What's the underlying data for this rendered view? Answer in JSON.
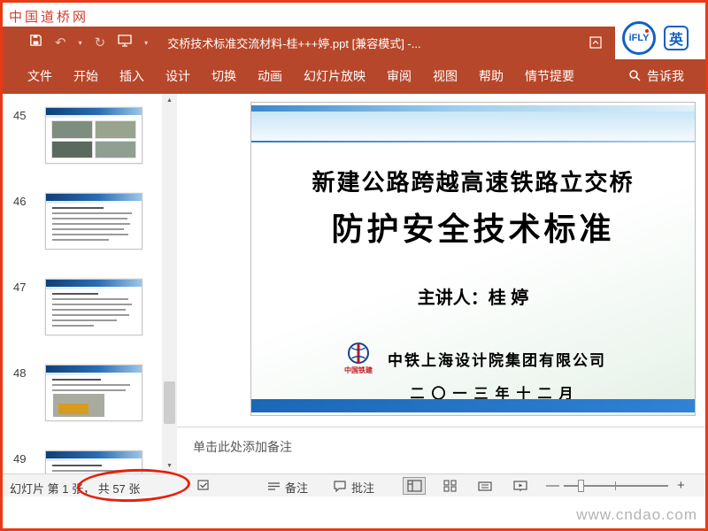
{
  "watermarks": {
    "top_left": "中国道桥网",
    "bottom_right": "www.cndao.com"
  },
  "ime": {
    "ifly": "iFLY",
    "lang": "英"
  },
  "titlebar": {
    "title": "交桥技术标准交流材料-桂+++婷.ppt [兼容模式]  -...",
    "undo_glyph": "↶",
    "redo_glyph": "↻",
    "qat_caret": "▾"
  },
  "ribbon": {
    "tabs": [
      {
        "label": "文件"
      },
      {
        "label": "开始"
      },
      {
        "label": "插入"
      },
      {
        "label": "设计"
      },
      {
        "label": "切换"
      },
      {
        "label": "动画"
      },
      {
        "label": "幻灯片放映"
      },
      {
        "label": "审阅"
      },
      {
        "label": "视图"
      },
      {
        "label": "帮助"
      },
      {
        "label": "情节提要"
      }
    ],
    "tellme_label": "告诉我"
  },
  "thumbs": {
    "scroll_up_glyph": "▲",
    "scroll_down_glyph": "▼",
    "slides": [
      {
        "number": "45"
      },
      {
        "number": "46"
      },
      {
        "number": "47"
      },
      {
        "number": "48"
      },
      {
        "number": "49"
      }
    ]
  },
  "slide": {
    "title_line1": "新建公路跨越高速铁路立交桥",
    "title_line2": "防护安全技术标准",
    "presenter": "主讲人：桂  婷",
    "logo_label": "中国铁建",
    "company": "中铁上海设计院集团有限公司",
    "date_line": "二〇一三年十二月"
  },
  "notes": {
    "placeholder": "单击此处添加备注"
  },
  "statusbar": {
    "slide_counter_prefix": "幻灯片 第 1 张，",
    "slide_counter_total": "共 57 张",
    "notes_label": "备注",
    "comments_label": "批注",
    "zoom_minus": "—",
    "zoom_plus": "+"
  },
  "colors": {
    "ribbon_red": "#b7472a",
    "slide_accent_blue": "#2173c4",
    "annotation_red": "#e3210f",
    "ime_blue": "#1260c4"
  }
}
